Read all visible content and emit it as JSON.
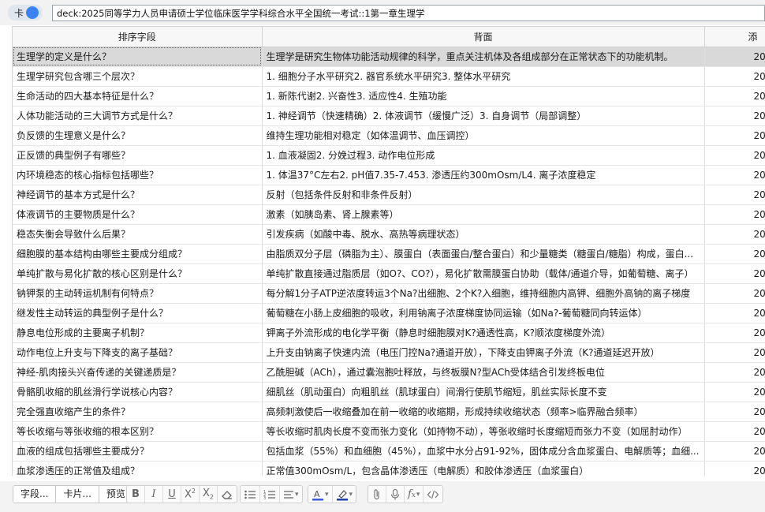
{
  "topbar": {
    "toggle_label": "卡",
    "search_value": "deck:2025同等学力人员申请硕士学位临床医学学科综合水平全国统一考试::1第一章生理学"
  },
  "table": {
    "columns": [
      "排序字段",
      "背面",
      "添"
    ],
    "rows": [
      {
        "question": "生理学的定义是什么？",
        "answer": "生理学是研究生物体功能活动规律的科学，重点关注机体及各组成部分在正常状态下的功能机制。",
        "date": "202"
      },
      {
        "question": "生理学研究包含哪三个层次？",
        "answer": "1. 细胞分子水平研究2. 器官系统水平研究3. 整体水平研究",
        "date": "202"
      },
      {
        "question": "生命活动的四大基本特征是什么？",
        "answer": "1. 新陈代谢2. 兴奋性3. 适应性4. 生殖功能",
        "date": "202"
      },
      {
        "question": "人体功能活动的三大调节方式是什么？",
        "answer": "1. 神经调节（快速精确）2. 体液调节（缓慢广泛）3. 自身调节（局部调整）",
        "date": "202"
      },
      {
        "question": "负反馈的生理意义是什么？",
        "answer": "维持生理功能相对稳定（如体温调节、血压调控）",
        "date": "202"
      },
      {
        "question": "正反馈的典型例子有哪些？",
        "answer": "1. 血液凝固2. 分娩过程3. 动作电位形成",
        "date": "202"
      },
      {
        "question": "内环境稳态的核心指标包括哪些？",
        "answer": "1. 体温37°C左右2. pH值7.35-7.453. 渗透压约300mOsm/L4. 离子浓度稳定",
        "date": "202"
      },
      {
        "question": "神经调节的基本方式是什么？",
        "answer": "反射（包括条件反射和非条件反射）",
        "date": "202"
      },
      {
        "question": "体液调节的主要物质是什么？",
        "answer": "激素（如胰岛素、肾上腺素等）",
        "date": "202"
      },
      {
        "question": "稳态失衡会导致什么后果？",
        "answer": "引发疾病（如酸中毒、脱水、高热等病理状态）",
        "date": "202"
      },
      {
        "question": "细胞膜的基本结构由哪些主要成分组成？",
        "answer": "由脂质双分子层（磷脂为主）、膜蛋白（表面蛋白/整合蛋白）和少量糖类（糖蛋白/糖脂）构成，蛋白...",
        "date": "202"
      },
      {
        "question": "单纯扩散与易化扩散的核心区别是什么？",
        "answer": "单纯扩散直接通过脂质层（如O?、CO?），易化扩散需膜蛋白协助（载体/通道介导，如葡萄糖、离子）",
        "date": "202"
      },
      {
        "question": "钠钾泵的主动转运机制有何特点？",
        "answer": "每分解1分子ATP逆浓度转运3个Na?出细胞、2个K?入细胞，维持细胞内高钾、细胞外高钠的离子梯度",
        "date": "202"
      },
      {
        "question": "继发性主动转运的典型例子是什么？",
        "answer": "葡萄糖在小肠上皮细胞的吸收，利用钠离子浓度梯度协同运输（如Na?-葡萄糖同向转运体）",
        "date": "202"
      },
      {
        "question": "静息电位形成的主要离子机制？",
        "answer": "钾离子外流形成的电化学平衡（静息时细胞膜对K?通透性高，K?顺浓度梯度外流）",
        "date": "202"
      },
      {
        "question": "动作电位上升支与下降支的离子基础？",
        "answer": "上升支由钠离子快速内流（电压门控Na?通道开放），下降支由钾离子外流（K?通道延迟开放）",
        "date": "202"
      },
      {
        "question": "神经-肌肉接头兴奋传递的关键递质是？",
        "answer": "乙酰胆碱（ACh），通过囊泡胞吐释放，与终板膜N?型ACh受体结合引发终板电位",
        "date": "202"
      },
      {
        "question": "骨骼肌收缩的肌丝滑行学说核心内容？",
        "answer": "细肌丝（肌动蛋白）向粗肌丝（肌球蛋白）间滑行使肌节缩短，肌丝实际长度不变",
        "date": "202"
      },
      {
        "question": "完全强直收缩产生的条件？",
        "answer": "高频刺激使后一收缩叠加在前一收缩的收缩期，形成持续收缩状态（频率>临界融合频率）",
        "date": "202"
      },
      {
        "question": "等长收缩与等张收缩的根本区别？",
        "answer": "等长收缩时肌肉长度不变而张力变化（如持物不动），等张收缩时长度缩短而张力不变（如屈肘动作）",
        "date": "202"
      },
      {
        "question": "血液的组成包括哪些主要成分？",
        "answer": "包括血浆（55%）和血细胞（45%），血浆中水分占91-92%，固体成分含血浆蛋白、电解质等；血细...",
        "date": "202"
      },
      {
        "question": "血浆渗透压的正常值及组成？",
        "answer": "正常值300mOsm/L，包含晶体渗透压（电解质）和胶体渗透压（血浆蛋白）",
        "date": "202"
      }
    ]
  },
  "toolbar": {
    "fields_label": "字段...",
    "cards_label": "卡片...",
    "preview_label": "预览",
    "buttons": [
      "bold-icon",
      "italic-icon",
      "underline-icon",
      "superscript-icon",
      "subscript-icon",
      "eraser-icon",
      "bulleted-list-icon",
      "numbered-list-icon",
      "align-icon",
      "text-color-icon",
      "highlight-icon",
      "attachment-icon",
      "microphone-icon",
      "function-icon",
      "html-code-icon"
    ],
    "text_color": "#3b5bdb",
    "highlight_color": "#1f3fae"
  }
}
